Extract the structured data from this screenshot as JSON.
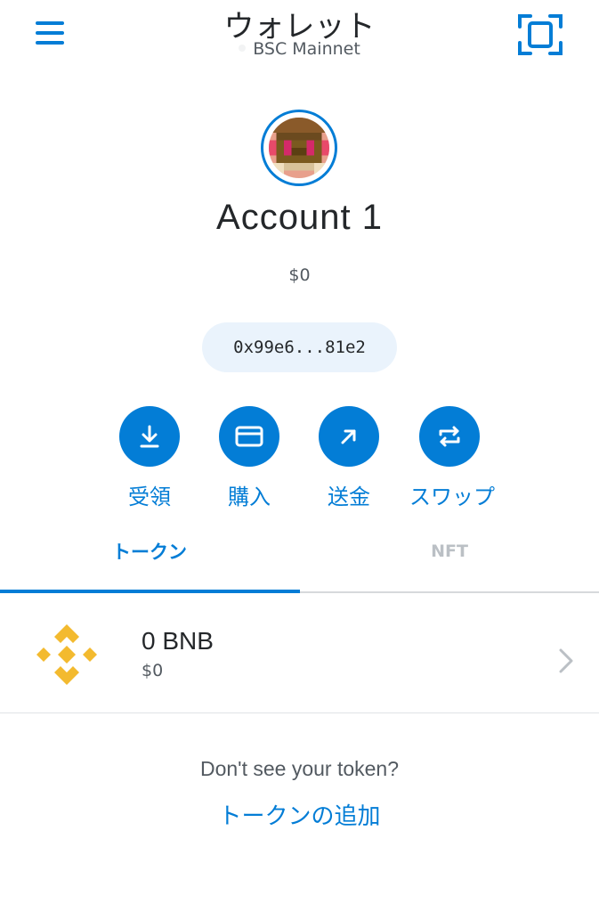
{
  "header": {
    "title": "ウォレット",
    "network": "BSC Mainnet",
    "menu_icon": "hamburger-menu-icon",
    "scan_icon": "qr-scan-icon"
  },
  "account": {
    "name": "Account 1",
    "balance": "$0",
    "address": "0x99e6...81e2"
  },
  "actions": [
    {
      "label": "受領",
      "icon": "download-icon"
    },
    {
      "label": "購入",
      "icon": "card-icon"
    },
    {
      "label": "送金",
      "icon": "arrow-up-right-icon"
    },
    {
      "label": "スワップ",
      "icon": "swap-icon"
    }
  ],
  "tabs": [
    {
      "label": "トークン",
      "active": true
    },
    {
      "label": "NFT",
      "active": false
    }
  ],
  "tokens": [
    {
      "amount": "0 BNB",
      "fiat": "$0",
      "icon": "bnb-logo-icon"
    }
  ],
  "footer": {
    "prompt": "Don't see your token?",
    "add_link": "トークンの追加"
  },
  "colors": {
    "accent": "#037dd6",
    "address_bg": "#eaf3fc",
    "bnb": "#f3ba2f"
  }
}
